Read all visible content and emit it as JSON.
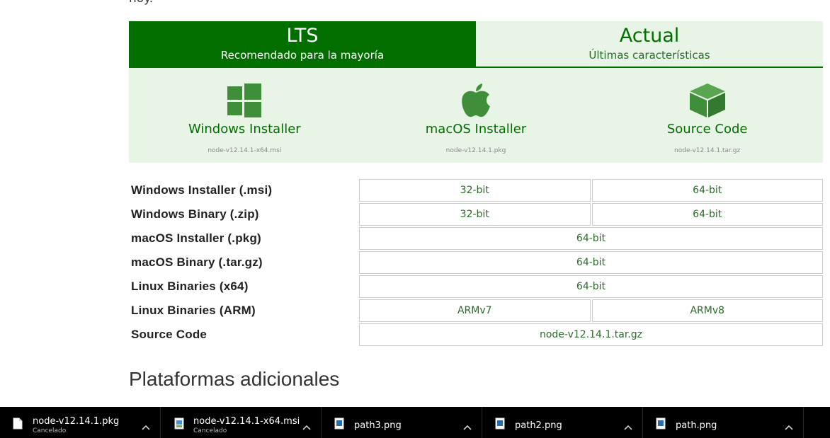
{
  "page": {
    "cut_text": "hoy."
  },
  "tabs": [
    {
      "title": "LTS",
      "subtitle": "Recomendado para la mayoría"
    },
    {
      "title": "Actual",
      "subtitle": "Últimas características"
    }
  ],
  "cards": [
    {
      "icon": "windows-icon",
      "label": "Windows Installer",
      "file": "node-v12.14.1-x64.msi"
    },
    {
      "icon": "apple-icon",
      "label": "macOS Installer",
      "file": "node-v12.14.1.pkg"
    },
    {
      "icon": "box-icon",
      "label": "Source Code",
      "file": "node-v12.14.1.tar.gz"
    }
  ],
  "downloads": [
    {
      "label": "Windows Installer (.msi)",
      "options": [
        "32-bit",
        "64-bit"
      ]
    },
    {
      "label": "Windows Binary (.zip)",
      "options": [
        "32-bit",
        "64-bit"
      ]
    },
    {
      "label": "macOS Installer (.pkg)",
      "options": [
        "64-bit"
      ]
    },
    {
      "label": "macOS Binary (.tar.gz)",
      "options": [
        "64-bit"
      ]
    },
    {
      "label": "Linux Binaries (x64)",
      "options": [
        "64-bit"
      ]
    },
    {
      "label": "Linux Binaries (ARM)",
      "options": [
        "ARMv7",
        "ARMv8"
      ]
    },
    {
      "label": "Source Code",
      "options": [
        "node-v12.14.1.tar.gz"
      ]
    }
  ],
  "section": {
    "title": "Plataformas adicionales"
  },
  "download_bar": [
    {
      "name": "node-v12.14.1.pkg",
      "status": "Cancelado",
      "icon": "file-icon"
    },
    {
      "name": "node-v12.14.1-x64.msi",
      "status": "Cancelado",
      "icon": "installer-icon"
    },
    {
      "name": "path3.png",
      "status": "",
      "icon": "image-file-icon"
    },
    {
      "name": "path2.png",
      "status": "",
      "icon": "image-file-icon"
    },
    {
      "name": "path.png",
      "status": "",
      "icon": "image-file-icon"
    }
  ],
  "colors": {
    "brand_green": "#026e00",
    "light_green": "#e8f4e6"
  }
}
